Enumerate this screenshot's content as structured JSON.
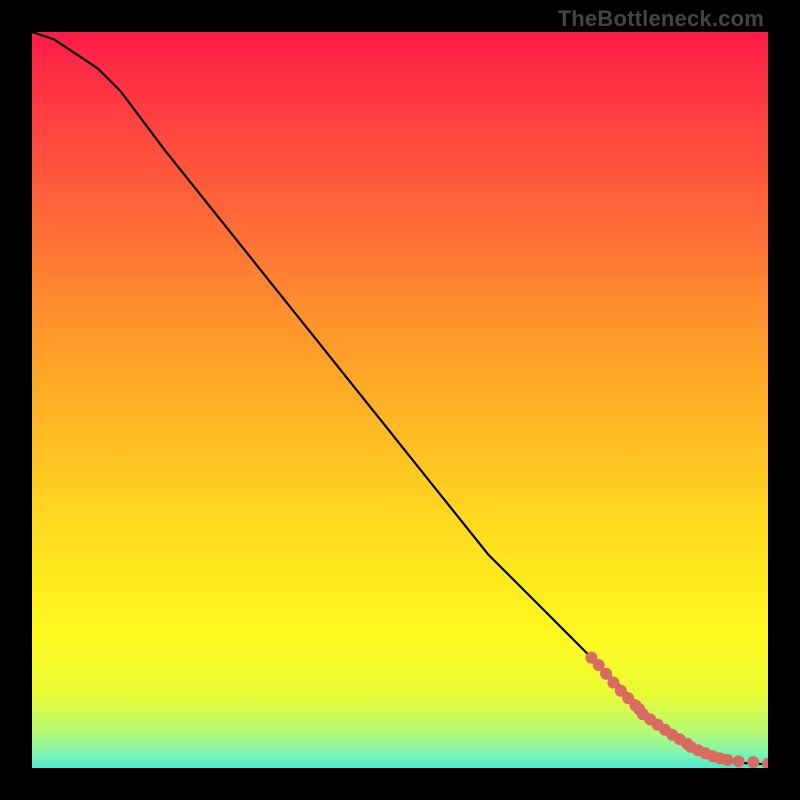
{
  "watermark": "TheBottleneck.com",
  "chart_data": {
    "type": "line",
    "title": "",
    "xlabel": "",
    "ylabel": "",
    "xlim": [
      0,
      100
    ],
    "ylim": [
      0,
      100
    ],
    "series": [
      {
        "name": "curve",
        "style": "solid-black",
        "x": [
          0,
          3,
          6,
          9,
          12,
          15,
          18,
          22,
          26,
          30,
          34,
          38,
          42,
          46,
          50,
          54,
          58,
          62,
          66,
          70,
          74,
          78,
          82,
          85,
          88,
          90,
          92,
          94,
          96,
          98,
          100
        ],
        "y": [
          100,
          99,
          97,
          95,
          92,
          88,
          84,
          79,
          74,
          69,
          64,
          59,
          54,
          49,
          44,
          39,
          34,
          29,
          25,
          21,
          17,
          13,
          9,
          6,
          4,
          2.5,
          1.5,
          1,
          0.7,
          0.6,
          0.5
        ]
      },
      {
        "name": "markers",
        "style": "circle-coral",
        "x": [
          76,
          77,
          78,
          79,
          80,
          81,
          82,
          82.5,
          83,
          84,
          85,
          86,
          87,
          88,
          89,
          89.5,
          90.5,
          91.5,
          92.5,
          93.5,
          94.5,
          96,
          98,
          100
        ],
        "y": [
          15,
          14,
          12.8,
          11.6,
          10.5,
          9.5,
          8.5,
          8.0,
          7.3,
          6.6,
          5.9,
          5.2,
          4.5,
          3.9,
          3.3,
          2.9,
          2.4,
          2.0,
          1.6,
          1.3,
          1.1,
          0.9,
          0.8,
          0.6
        ]
      }
    ],
    "marker_color": "#d86a5f",
    "line_color": "#000000"
  }
}
